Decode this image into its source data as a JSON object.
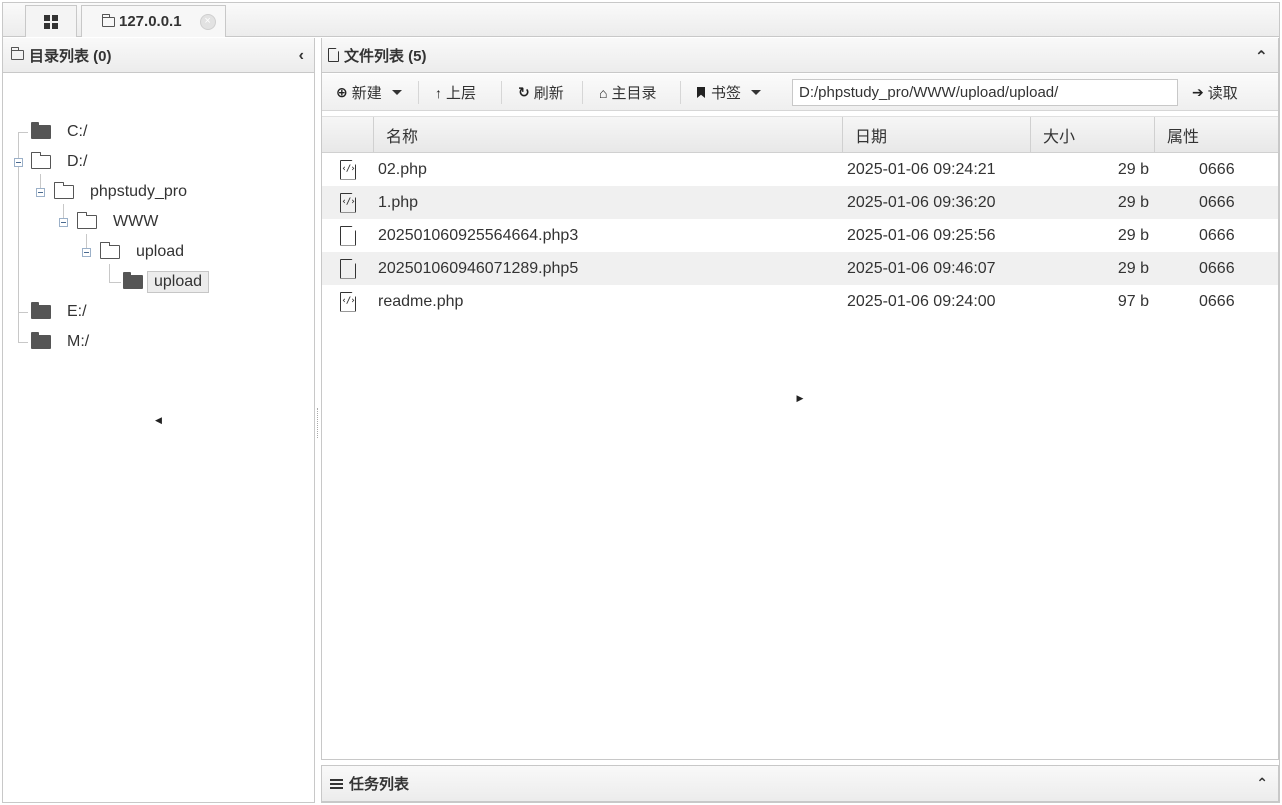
{
  "tabs": {
    "home_icon": "grid-icon",
    "host_label": "127.0.0.1",
    "close_glyph": "×",
    "scroll_left": "◀",
    "scroll_right": "▶"
  },
  "left_panel": {
    "title": "目录列表 (0)",
    "collapse_glyph": "‹",
    "tree": [
      {
        "label": "C:/",
        "icon": "folder-solid",
        "selected": false
      },
      {
        "label": "D:/",
        "icon": "folder-open",
        "selected": false
      },
      {
        "label": "phpstudy_pro",
        "icon": "folder-open",
        "selected": false
      },
      {
        "label": "WWW",
        "icon": "folder-open",
        "selected": false
      },
      {
        "label": "upload",
        "icon": "folder-open",
        "selected": false
      },
      {
        "label": "upload",
        "icon": "folder-solid",
        "selected": true
      },
      {
        "label": "E:/",
        "icon": "folder-solid",
        "selected": false
      },
      {
        "label": "M:/",
        "icon": "folder-solid",
        "selected": false
      }
    ]
  },
  "right_panel": {
    "title": "文件列表 (5)",
    "collapse_glyph": "⌃",
    "toolbar": {
      "new_label": "新建",
      "up_label": "上层",
      "refresh_label": "刷新",
      "home_label": "主目录",
      "bookmark_label": "书签",
      "path_value": "D:/phpstudy_pro/WWW/upload/upload/",
      "read_label": "读取"
    },
    "columns": [
      "名称",
      "日期",
      "大小",
      "属性"
    ],
    "files": [
      {
        "name": "02.php",
        "date": "2025-01-06 09:24:21",
        "size": "29 b",
        "perm": "0666",
        "icon": "code-file-icon"
      },
      {
        "name": "1.php",
        "date": "2025-01-06 09:36:20",
        "size": "29 b",
        "perm": "0666",
        "icon": "code-file-icon"
      },
      {
        "name": "202501060925564664.php3",
        "date": "2025-01-06 09:25:56",
        "size": "29 b",
        "perm": "0666",
        "icon": "file-icon"
      },
      {
        "name": "202501060946071289.php5",
        "date": "2025-01-06 09:46:07",
        "size": "29 b",
        "perm": "0666",
        "icon": "file-icon"
      },
      {
        "name": "readme.php",
        "date": "2025-01-06 09:24:00",
        "size": "97 b",
        "perm": "0666",
        "icon": "code-file-icon"
      }
    ]
  },
  "task_panel": {
    "title": "任务列表",
    "collapse_glyph": "⌃"
  }
}
